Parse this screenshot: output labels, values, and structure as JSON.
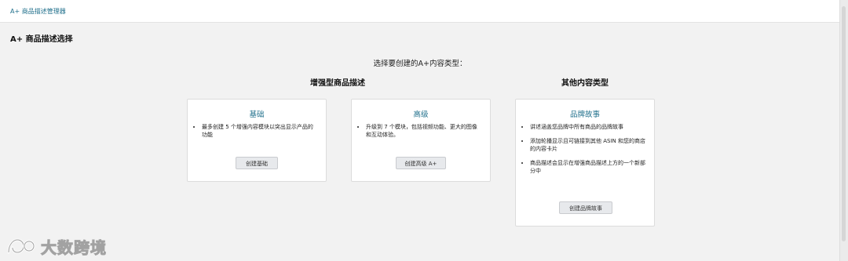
{
  "topbar": {
    "breadcrumb": "A+ 商品描述管理器"
  },
  "page": {
    "title": "A+ 商品描述选择",
    "prompt": "选择要创建的A+内容类型："
  },
  "sections": {
    "enhanced_heading": "增强型商品描述",
    "other_heading": "其他内容类型"
  },
  "cards": {
    "basic": {
      "title": "基础",
      "bullets": [
        "最多创建 5 个增强内容模块以突出显示产品的功能"
      ],
      "button": "创建基础"
    },
    "premium": {
      "title": "高级",
      "bullets": [
        "升级到 7 个模块，包括视频功能、更大的图像和互动体验。"
      ],
      "button": "创建高级 A+"
    },
    "brand_story": {
      "title": "品牌故事",
      "bullets": [
        "讲述涵盖您品牌中所有商品的品牌故事",
        "添加轮播显示且可链接到其他 ASIN 和您的商店的内容卡片",
        "商品描述会显示在增强商品描述上方的一个新部分中"
      ],
      "button": "创建品牌故事"
    }
  },
  "watermark": {
    "text": "大数跨境"
  },
  "colors": {
    "link": "#1f6f8b",
    "background": "#f2f2f2",
    "card": "#ffffff"
  }
}
